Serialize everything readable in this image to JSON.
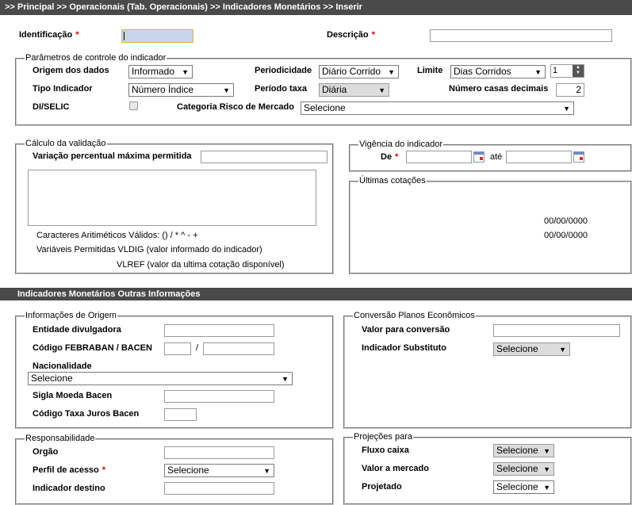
{
  "breadcrumb": ">> Principal >> Operacionais (Tab. Operacionais) >> Indicadores Monetários >> Inserir",
  "top": {
    "identificacao_label": "Identificação",
    "descricao_label": "Descrição",
    "required_mark": "*"
  },
  "parametros": {
    "legend": "Parâmetros de controle do indicador",
    "origem_label": "Origem dos dados",
    "origem_value": "Informado",
    "periodicidade_label": "Periodicidade",
    "periodicidade_value": "Diário Corrido",
    "limite_label": "Limite",
    "limite_value": "Dias Corridos",
    "limite_number": "1",
    "tipo_label": "Tipo Indicador",
    "tipo_value": "Número Índice",
    "periodo_taxa_label": "Período taxa",
    "periodo_taxa_value": "Diária",
    "casas_label": "Número casas decimais",
    "casas_value": "2",
    "diselic_label": "DI/SELIC",
    "categoria_label": "Categoria Risco de Mercado",
    "categoria_value": "Selecione"
  },
  "calculo": {
    "legend": "Cálculo da validação",
    "variacao_label": "Variação percentual máxima permitida",
    "caracteres": "Caracteres Aritiméticos Válidos: () / * ^ - +",
    "variaveis": "Variáveis Permitidas VLDIG (valor informado do indicador)",
    "vlref": "VLREF (valor da ultima cotação disponível)"
  },
  "vigencia": {
    "legend": "Vigência do indicador",
    "de_label": "De",
    "ate_label": "até"
  },
  "cotacoes": {
    "legend": "Últimas cotações",
    "dates": [
      "00/00/0000",
      "00/00/0000"
    ]
  },
  "outras_bar": "Indicadores Monetários Outras Informações",
  "origem_info": {
    "legend": "Informações de Origem",
    "entidade_label": "Entidade divulgadora",
    "febraban_label": "Código FEBRABAN / BACEN",
    "slash": "/",
    "nacionalidade_label": "Nacionalidade",
    "nacionalidade_value": "Selecione",
    "sigla_label": "Sigla Moeda Bacen",
    "codigo_taxa_label": "Código Taxa Juros Bacen"
  },
  "conversao": {
    "legend": "Conversão Planos Econômicos",
    "valor_label": "Valor para conversão",
    "substituto_label": "Indicador Substituto",
    "substituto_value": "Selecione"
  },
  "responsabilidade": {
    "legend": "Responsabilidade",
    "orgao_label": "Orgão",
    "perfil_label": "Perfil de acesso",
    "perfil_value": "Selecione",
    "destino_label": "Indicador destino"
  },
  "projecoes": {
    "legend": "Projeções para",
    "fluxo_label": "Fluxo caixa",
    "fluxo_value": "Selecione",
    "mercado_label": "Valor a mercado",
    "mercado_value": "Selecione",
    "projetado_label": "Projetado",
    "projetado_value": "Selecione"
  }
}
